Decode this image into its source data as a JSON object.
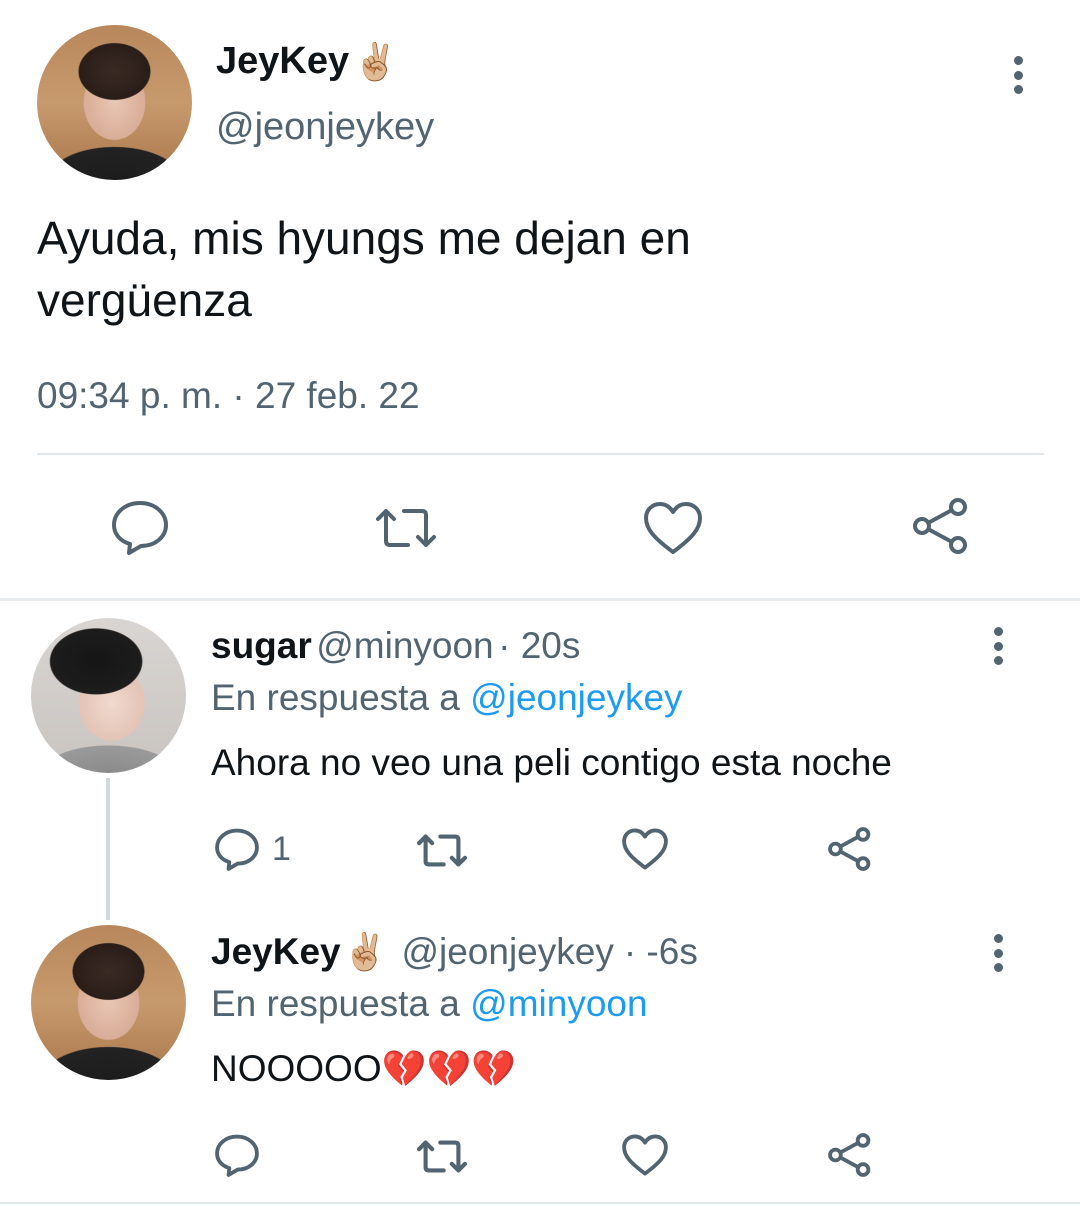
{
  "main_tweet": {
    "author_name": "JeyKey",
    "author_emoji": "✌🏼",
    "author_handle": "@jeonjeykey",
    "text_line1": "Ayuda, mis hyungs me dejan en",
    "text_line2": "vergüenza",
    "timestamp": "09:34 p. m. · 27 feb. 22",
    "actions": [
      "reply-icon",
      "retweet-icon",
      "like-icon",
      "share-icon"
    ]
  },
  "replies": [
    {
      "author_name": "sugar",
      "author_handle": "@minyoon",
      "time": "· 20s",
      "reply_prefix": "En respuesta a",
      "reply_to": "@jeonjeykey",
      "text": "Ahora no veo una peli contigo esta noche",
      "reply_count": "1"
    },
    {
      "author_name": "JeyKey",
      "author_emoji": "✌🏼",
      "author_handle": "@jeonjeykey",
      "time": "· -6s",
      "reply_prefix": "En respuesta a",
      "reply_to": "@minyoon",
      "text": "NOOOOO",
      "text_emoji": "💔💔💔"
    }
  ],
  "colors": {
    "text": "#0f1419",
    "secondary": "#536471",
    "link": "#1d9bf0",
    "divider": "#e1e6ea"
  }
}
